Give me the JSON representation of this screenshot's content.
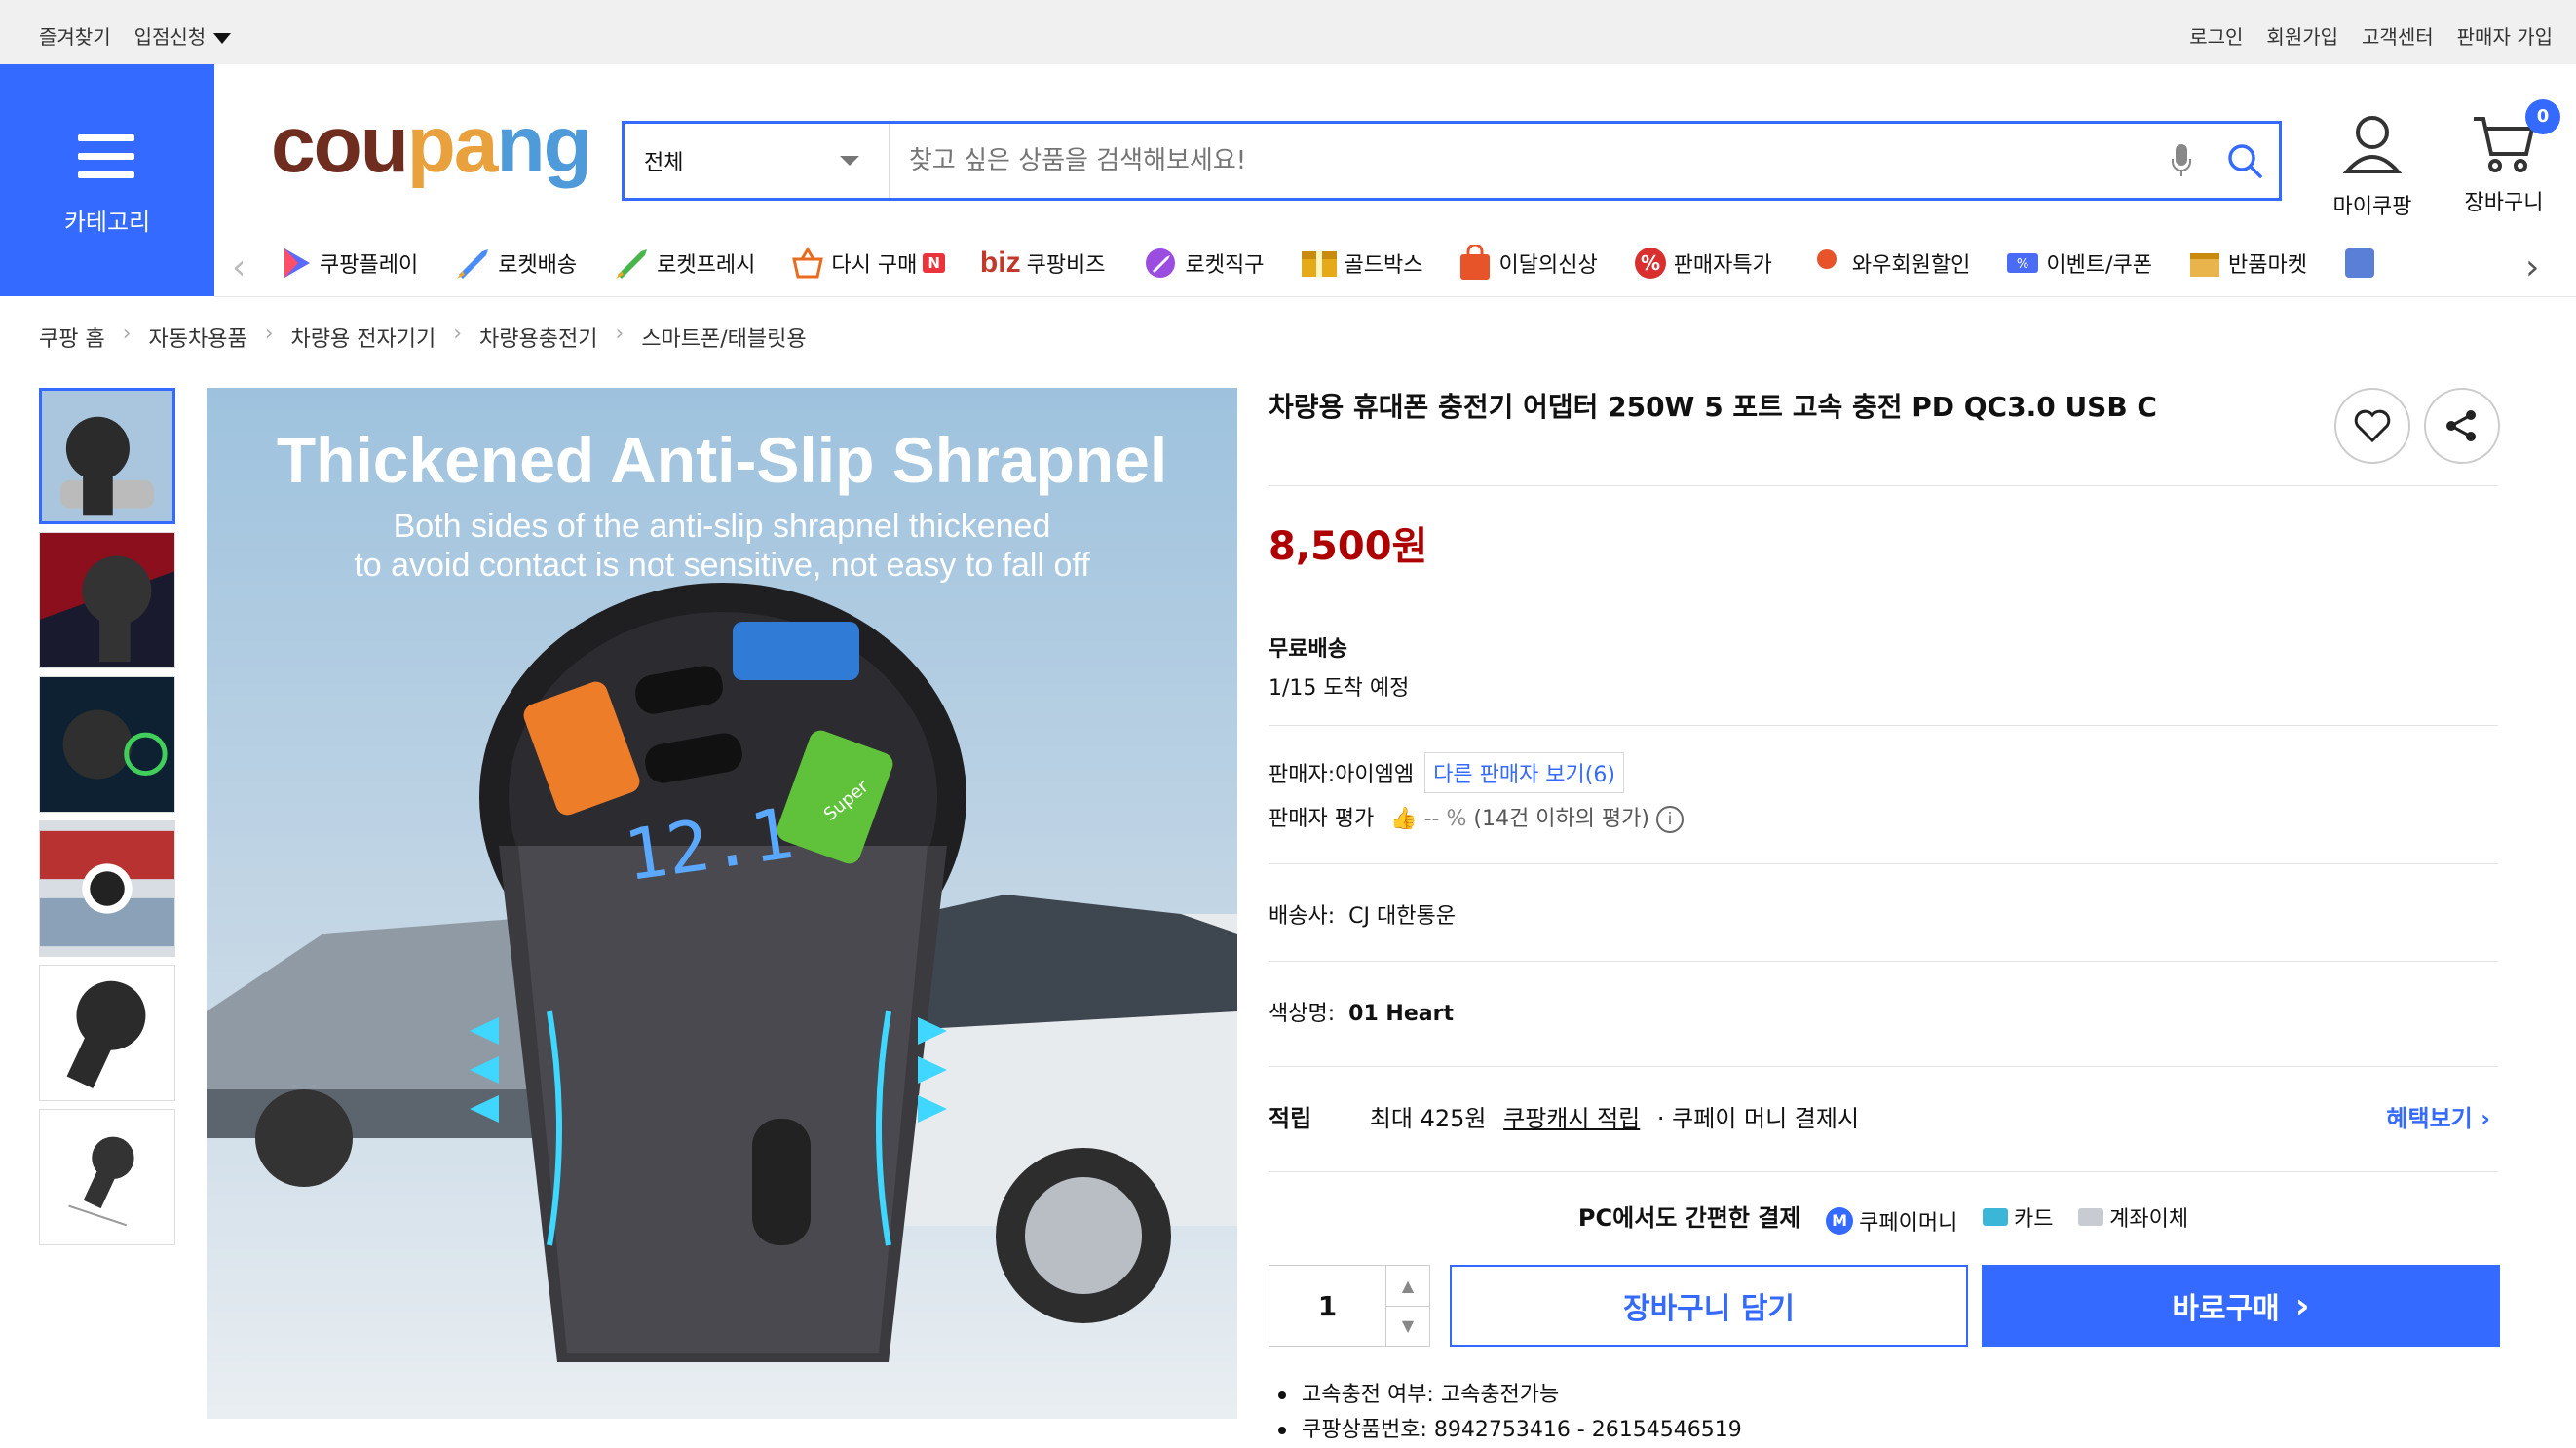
{
  "top_bar": {
    "left": [
      "즐겨찾기",
      "입점신청"
    ],
    "right": [
      "로그인",
      "회원가입",
      "고객센터",
      "판매자 가입"
    ]
  },
  "category_button": {
    "label": "카테고리",
    "icon": "hamburger-icon"
  },
  "logo": {
    "part1": "cou",
    "part2": "pa",
    "part3": "ng"
  },
  "search": {
    "scope": "전체",
    "placeholder": "찾고 싶은 상품을 검색해보세요!"
  },
  "header_icons": {
    "my_coupang": "마이쿠팡",
    "cart": "장바구니",
    "cart_count": "0"
  },
  "nav": {
    "items": [
      "쿠팡플레이",
      "로켓배송",
      "로켓프레시",
      "다시 구매",
      "쿠팡비즈",
      "로켓직구",
      "골드박스",
      "이달의신상",
      "판매자특가",
      "와우회원할인",
      "이벤트/쿠폰",
      "반품마켓"
    ],
    "biz_prefix": "biz",
    "badge_n": "N"
  },
  "breadcrumbs": [
    "쿠팡 홈",
    "자동차용품",
    "차량용 전자기기",
    "차량용충전기",
    "스마트폰/태블릿용"
  ],
  "product_image": {
    "headline": "Thickened Anti-Slip Shrapnel",
    "subline1": "Both sides of the anti-slip shrapnel thickened",
    "subline2": "to avoid contact is not sensitive, not easy to fall off",
    "display_value": "12.1",
    "port_label": "Super"
  },
  "product": {
    "title": "차량용 휴대폰 충전기 어댑터 250W 5 포트 고속 충전 PD QC3.0 USB C",
    "price": "8,500원",
    "shipping_label": "무료배송",
    "arrival": "1/15 도착 예정",
    "seller_label": "판매자:",
    "seller_name": "아이엠엠",
    "other_seller": "다른 판매자 보기(6)",
    "seller_rating_label": "판매자 평가",
    "seller_rating_value": "-- %",
    "seller_rating_note": "(14건 이하의 평가)",
    "carrier_label": "배송사:",
    "carrier": "CJ 대한통운",
    "color_label": "색상명:",
    "color": "01 Heart",
    "reward_label": "적립",
    "reward_max": "최대 425원",
    "reward_link": "쿠팡캐시 적립",
    "reward_note": "· 쿠페이 머니 결제시",
    "benefit_link": "혜택보기",
    "pay_title": "PC에서도 간편한 결제",
    "pay_methods": [
      "쿠페이머니",
      "카드",
      "계좌이체"
    ],
    "quantity": "1",
    "add_to_cart": "장바구니 담기",
    "buy_now": "바로구매",
    "bullets": [
      "고속충전 여부: 고속충전가능",
      "쿠팡상품번호: 8942753416 - 26154546519"
    ]
  },
  "colors": {
    "accent": "#346aff",
    "price": "#ae0000"
  }
}
